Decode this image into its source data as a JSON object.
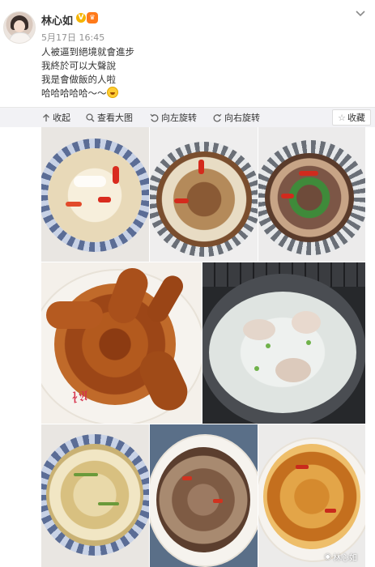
{
  "user": {
    "name": "林心如",
    "verify_badge_text": "V",
    "vip_badge_text": "👑"
  },
  "post": {
    "timestamp": "5月17日 16:45",
    "lines": [
      "人被逼到絕境就會進步",
      "我終於可以大聲說",
      "我是會做飯的人啦",
      "哈哈哈哈哈～～"
    ]
  },
  "toolbar": {
    "collapse_label": "收起",
    "view_large_label": "查看大图",
    "rotate_left_label": "向左旋转",
    "rotate_right_label": "向右旋转",
    "favorite_label": "收藏"
  },
  "photos": {
    "watermark_text": "林心如"
  },
  "colors": {
    "timestamp": "#939393",
    "toolbar_bg": "#f2f2f5",
    "verify_badge": "#f5b400",
    "vip_badge": "#ff7a1a"
  },
  "icons": [
    "chevron-down-icon",
    "collapse-icon",
    "zoom-icon",
    "rotate-left-icon",
    "rotate-right-icon",
    "star-icon"
  ]
}
